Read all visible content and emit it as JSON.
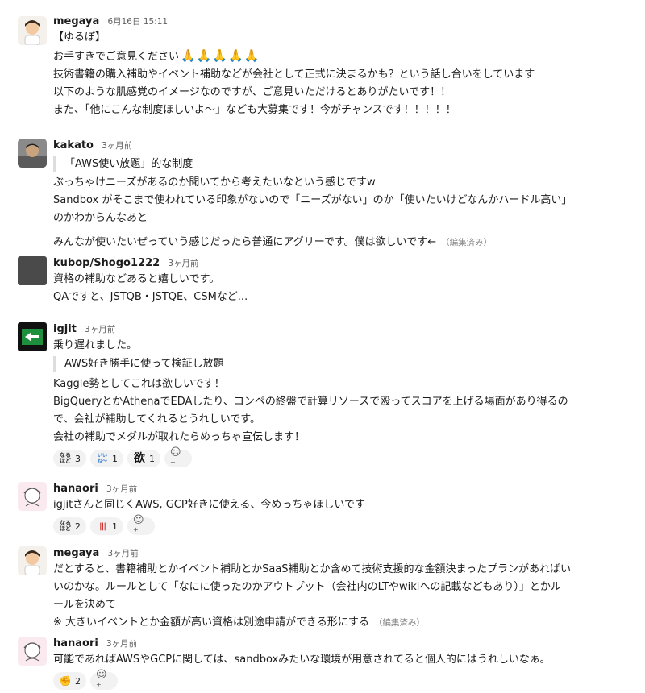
{
  "messages": [
    {
      "user": "megaya",
      "timestamp": "6月16日 15:11",
      "lines": [
        "【ゆるぼ】",
        "お手すきでご意見ください",
        "技術書籍の購入補助やイベント補助などが会社として正式に決まるかも？という話し合いをしています",
        "以下のような肌感覚のイメージなのですが、ご意見いただけるとありがたいです！！",
        "また、「他にこんな制度ほしいよ〜」なども大募集です！今がチャンスです！！！！！"
      ],
      "pray_emoji": "🙏🙏🙏🙏🙏"
    },
    {
      "user": "kakato",
      "timestamp": "3ヶ月前",
      "quote": "「AWS使い放題」的な制度",
      "lines": [
        "ぶっちゃけニーズがあるのか聞いてから考えたいなという感じですw",
        "Sandbox がそこまで使われている印象がないので「ニーズがない」のか「使いたいけどなんかハードル高い」",
        "のかわからんなあと",
        "みんなが使いたいぜっていう感じだったら普通にアグリーです。僕は欲しいです←"
      ],
      "edited": "（編集済み）"
    },
    {
      "user": "kubop/Shogo1222",
      "timestamp": "3ヶ月前",
      "lines": [
        "資格の補助などあると嬉しいです。",
        "QAですと、JSTQB・JSTQE、CSMなど..."
      ]
    },
    {
      "user": "igjit",
      "timestamp": "3ヶ月前",
      "lines_before_quote": [
        "乗り遅れました。"
      ],
      "quote": "AWS好き勝手に使って検証し放題",
      "lines": [
        "Kaggle勢としてこれは欲しいです！",
        "BigQueryとかAthenaでEDAしたり、コンペの終盤で計算リソースで殴ってスコアを上げる場面があり得るの",
        "で、会社が補助してくれるとうれしいです。",
        "会社の補助でメダルが取れたらめっちゃ宣伝します！"
      ],
      "reactions": [
        {
          "icon": "nanhodo-icon",
          "glyph": "なる\nほど",
          "count": "3"
        },
        {
          "icon": "iine-icon",
          "glyph": "いいね",
          "count": "1"
        },
        {
          "icon": "yoku-icon",
          "glyph": "欲",
          "count": "1"
        }
      ]
    },
    {
      "user": "hanaori",
      "timestamp": "3ヶ月前",
      "lines": [
        "igjitさんと同じくAWS, GCP好きに使える、今めっちゃほしいです"
      ],
      "reactions": [
        {
          "icon": "nanhodo-icon",
          "glyph": "なる\nほど",
          "count": "2"
        },
        {
          "icon": "stripe-icon",
          "glyph": "|||",
          "count": "1"
        }
      ]
    },
    {
      "user": "megaya",
      "timestamp": "3ヶ月前",
      "lines": [
        "だとすると、書籍補助とかイベント補助とかSaaS補助とか含めて技術支援的な金額決まったプランがあればい",
        "いのかな。ルールとして「なにに使ったのかアウトプット（会社内のLTやwikiへの記載などもあり）」とかル",
        "ールを決めて",
        "※ 大きいイベントとか金額が高い資格は別途申請ができる形にする"
      ],
      "edited": "（編集済み）"
    },
    {
      "user": "hanaori",
      "timestamp": "3ヶ月前",
      "lines": [
        "可能であればAWSやGCPに関しては、sandboxみたいな環境が用意されてると個人的にはうれしいなぁ。"
      ],
      "reactions": [
        {
          "icon": "fist-icon",
          "glyph": "✊",
          "count": "2"
        }
      ]
    }
  ],
  "colors": {
    "text": "#1d1c1d",
    "muted": "#616061",
    "reaction_bg": "#f2f2f2",
    "quote_bar": "#dddddd"
  }
}
